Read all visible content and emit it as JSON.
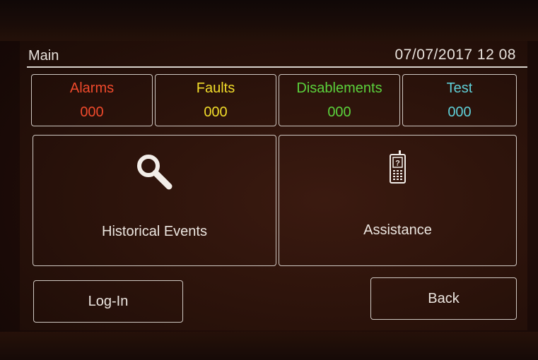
{
  "header": {
    "title": "Main",
    "datetime": "07/07/2017 12 08"
  },
  "status": [
    {
      "label": "Alarms",
      "count": "000",
      "color": "#f04a2c"
    },
    {
      "label": "Faults",
      "count": "000",
      "color": "#f2dd2a"
    },
    {
      "label": "Disablements",
      "count": "000",
      "color": "#5bd23c"
    },
    {
      "label": "Test",
      "count": "000",
      "color": "#5fd0d8"
    }
  ],
  "tiles": {
    "historical": {
      "label": "Historical Events",
      "icon": "magnifier-icon"
    },
    "assistance": {
      "label": "Assistance",
      "icon": "mobile-phone-question-icon",
      "icon_text": "?"
    }
  },
  "buttons": {
    "login": "Log-In",
    "back": "Back"
  }
}
